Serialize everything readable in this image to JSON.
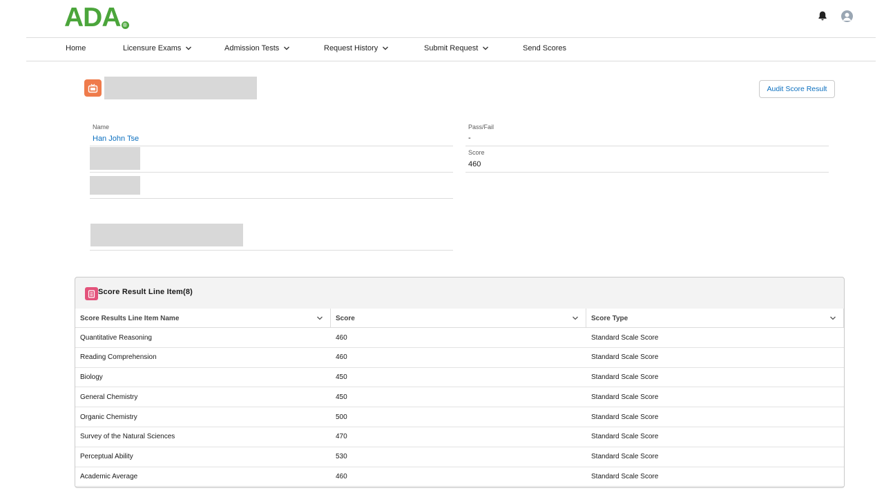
{
  "header": {
    "logo_text": "ADA",
    "logo_mark": "®",
    "icons": [
      "bell-icon",
      "user-avatar-icon"
    ]
  },
  "nav": [
    {
      "label": "Home",
      "has_menu": false
    },
    {
      "label": "Licensure Exams",
      "has_menu": true
    },
    {
      "label": "Admission Tests",
      "has_menu": true
    },
    {
      "label": "Request History",
      "has_menu": true
    },
    {
      "label": "Submit Request",
      "has_menu": true
    },
    {
      "label": "Send Scores",
      "has_menu": false
    }
  ],
  "record": {
    "audit_button_label": "Audit Score Result",
    "fields": {
      "name_label": "Name",
      "name_value": "Han John Tse",
      "passfail_label": "Pass/Fail",
      "passfail_value": "-",
      "score_label": "Score",
      "score_value": "460"
    }
  },
  "related": {
    "title": "Score Result Line Item(8)",
    "columns": [
      "Score Results Line Item Name",
      "Score",
      "Score Type"
    ],
    "rows": [
      {
        "name": "Quantitative Reasoning",
        "score": "460",
        "type": "Standard Scale Score"
      },
      {
        "name": "Reading Comprehension",
        "score": "460",
        "type": "Standard Scale Score"
      },
      {
        "name": "Biology",
        "score": "450",
        "type": "Standard Scale Score"
      },
      {
        "name": "General Chemistry",
        "score": "450",
        "type": "Standard Scale Score"
      },
      {
        "name": "Organic Chemistry",
        "score": "500",
        "type": "Standard Scale Score"
      },
      {
        "name": "Survey of the Natural Sciences",
        "score": "470",
        "type": "Standard Scale Score"
      },
      {
        "name": "Perceptual Ability",
        "score": "530",
        "type": "Standard Scale Score"
      },
      {
        "name": "Academic Average",
        "score": "460",
        "type": "Standard Scale Score"
      }
    ]
  },
  "colors": {
    "brand": "#4ba53b",
    "link": "#0b6fbf",
    "record_icon": "#ef7b4b",
    "card_icon": "#e3537b"
  }
}
